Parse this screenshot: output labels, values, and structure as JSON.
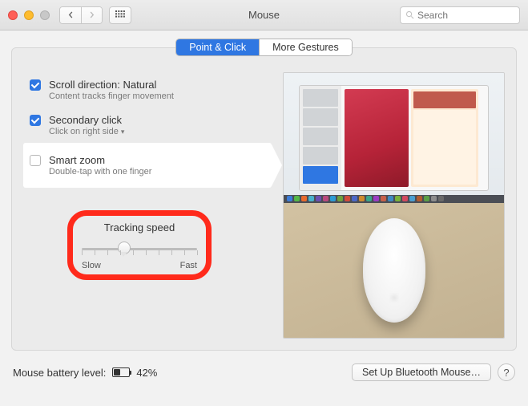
{
  "window": {
    "title": "Mouse"
  },
  "search": {
    "placeholder": "Search"
  },
  "tabs": {
    "point_click": "Point & Click",
    "more_gestures": "More Gestures",
    "active": "point_click"
  },
  "options": {
    "scroll": {
      "title": "Scroll direction: Natural",
      "subtitle": "Content tracks finger movement",
      "checked": true
    },
    "secondary": {
      "title": "Secondary click",
      "subtitle": "Click on right side",
      "checked": true,
      "has_dropdown": true
    },
    "zoom": {
      "title": "Smart zoom",
      "subtitle": "Double-tap with one finger",
      "checked": false
    }
  },
  "tracking": {
    "title": "Tracking speed",
    "slow_label": "Slow",
    "fast_label": "Fast",
    "value_percent": 36,
    "tick_count": 10
  },
  "footer": {
    "battery_label": "Mouse battery level:",
    "battery_percent": "42%",
    "battery_value": 42,
    "setup_button": "Set Up Bluetooth Mouse…",
    "help": "?"
  },
  "preview_dock_colors": [
    "#3c7dd9",
    "#55b748",
    "#e86a2c",
    "#48b1cc",
    "#6a4fb2",
    "#b94a7e",
    "#2c9bd4",
    "#6fa03c",
    "#d14a3c",
    "#4a68c9",
    "#ce8a2e",
    "#39a58a",
    "#9b3cc4",
    "#c7604a",
    "#3f8ac2",
    "#7ab23a",
    "#d3495f",
    "#4a9ed1",
    "#b25a2e",
    "#5a9e46",
    "#8c8c8c",
    "#6a6a6a"
  ]
}
